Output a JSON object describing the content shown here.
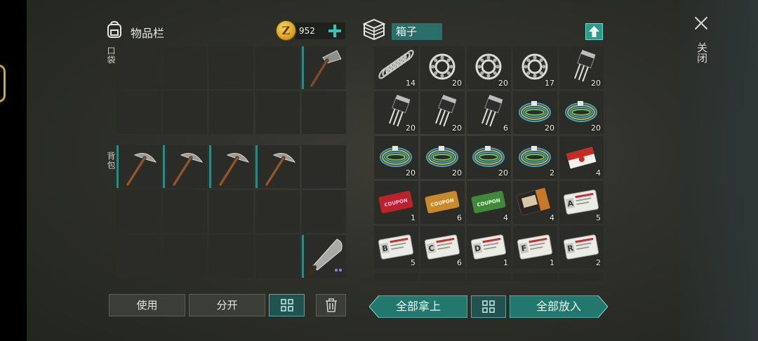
{
  "inventory": {
    "title": "物品栏",
    "coins": "952",
    "pocket_label": "口袋",
    "backpack_label": "背包",
    "pocket_slots": [
      {
        "icon": "empty"
      },
      {
        "icon": "empty"
      },
      {
        "icon": "empty"
      },
      {
        "icon": "empty"
      },
      {
        "icon": "hammer",
        "equipped": true
      },
      {
        "icon": "empty"
      },
      {
        "icon": "empty"
      },
      {
        "icon": "empty"
      },
      {
        "icon": "empty"
      },
      {
        "icon": "empty"
      }
    ],
    "backpack_slots": [
      {
        "icon": "pickaxe",
        "equipped": true
      },
      {
        "icon": "pickaxe",
        "equipped": true
      },
      {
        "icon": "pickaxe",
        "equipped": true
      },
      {
        "icon": "pickaxe",
        "equipped": true
      },
      {
        "icon": "empty"
      },
      {
        "icon": "empty"
      },
      {
        "icon": "empty"
      },
      {
        "icon": "empty"
      },
      {
        "icon": "empty"
      },
      {
        "icon": "empty"
      },
      {
        "icon": "empty"
      },
      {
        "icon": "empty"
      },
      {
        "icon": "empty"
      },
      {
        "icon": "empty"
      },
      {
        "icon": "machete",
        "equipped": true,
        "rarity_dots": 2
      }
    ],
    "buttons": {
      "use": "使用",
      "split": "分开"
    }
  },
  "box": {
    "title": "箱子",
    "slots": [
      {
        "icon": "spring",
        "qty": "14"
      },
      {
        "icon": "bearing",
        "qty": "20"
      },
      {
        "icon": "bearing",
        "qty": "20"
      },
      {
        "icon": "bearing",
        "qty": "17"
      },
      {
        "icon": "transistor",
        "qty": "20"
      },
      {
        "icon": "transistor",
        "qty": "20"
      },
      {
        "icon": "transistor",
        "qty": "20"
      },
      {
        "icon": "transistor",
        "qty": "6"
      },
      {
        "icon": "wire",
        "qty": "20"
      },
      {
        "icon": "wire",
        "qty": "20"
      },
      {
        "icon": "wire",
        "qty": "20"
      },
      {
        "icon": "wire",
        "qty": "20"
      },
      {
        "icon": "wire",
        "qty": "20"
      },
      {
        "icon": "wire",
        "qty": "2"
      },
      {
        "icon": "cigarettes",
        "qty": "4"
      },
      {
        "icon": "coupon-red",
        "qty": "1",
        "text": "COUPON"
      },
      {
        "icon": "coupon-orange",
        "qty": "6",
        "text": "COUPON"
      },
      {
        "icon": "coupon-green",
        "qty": "4",
        "text": "COUPON"
      },
      {
        "icon": "wallet",
        "qty": "4"
      },
      {
        "icon": "card",
        "qty": "5",
        "letter": "A"
      },
      {
        "icon": "card",
        "qty": "5",
        "letter": "B"
      },
      {
        "icon": "card",
        "qty": "6",
        "letter": "C"
      },
      {
        "icon": "card",
        "qty": "1",
        "letter": "D"
      },
      {
        "icon": "card",
        "qty": "1",
        "letter": "F"
      },
      {
        "icon": "card",
        "qty": "2",
        "letter": "R"
      }
    ],
    "take_all": "全部拿上",
    "put_all": "全部放入"
  },
  "close_label": "关闭",
  "colors": {
    "accent": "#2fc8b6",
    "button_teal": "#22524f",
    "slot_bg": "#2b2c27"
  }
}
